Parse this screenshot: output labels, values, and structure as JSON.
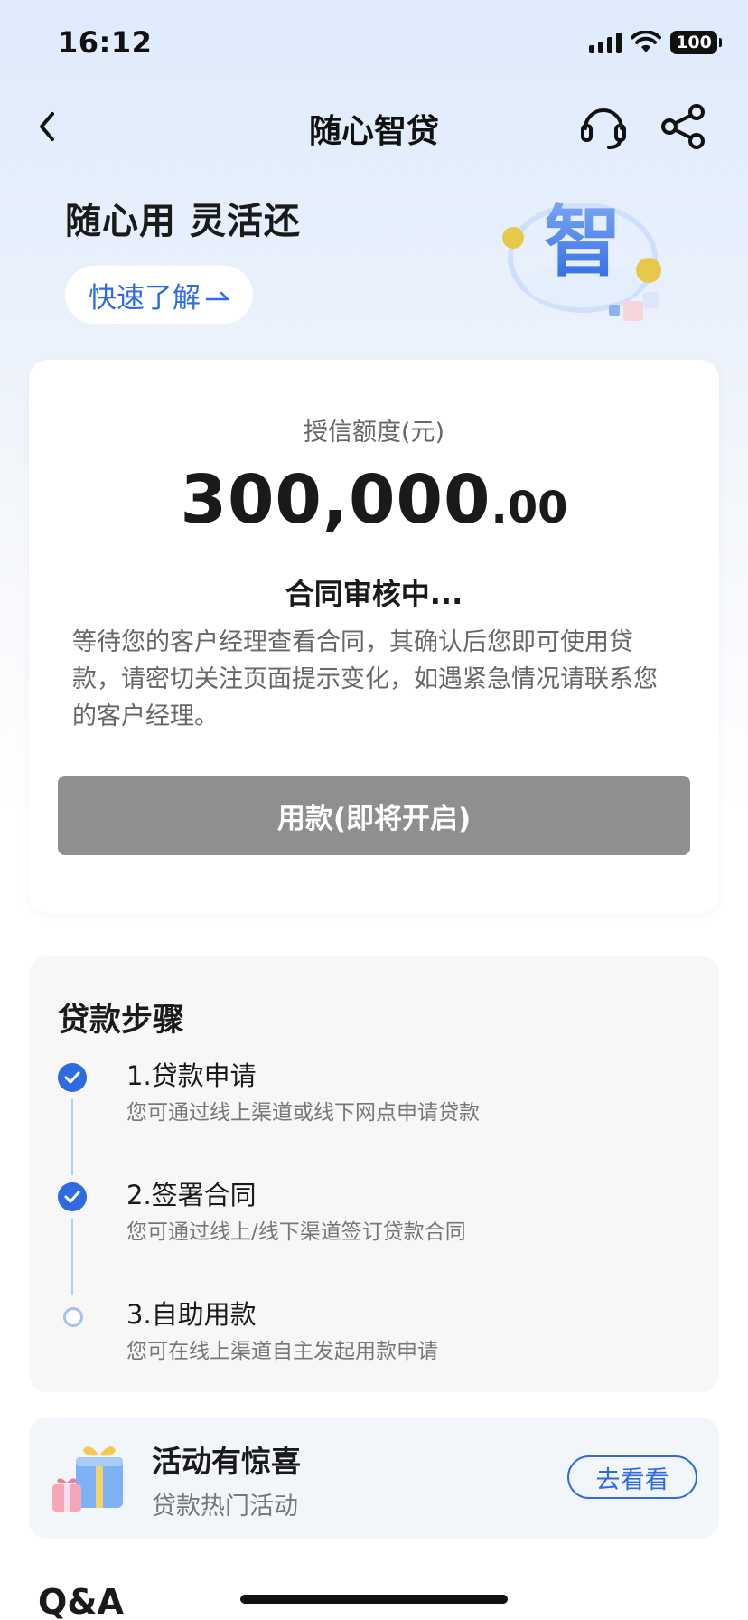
{
  "status_bar": {
    "time": "16:12",
    "battery": "100"
  },
  "nav": {
    "title": "随心智贷"
  },
  "hero": {
    "slogan": "随心用 灵活还",
    "learn_more": "快速了解",
    "graphic_char": "智"
  },
  "credit": {
    "label": "授信额度(元)",
    "amount_int": "300,000",
    "amount_dec": ".00",
    "status_title": "合同审核中...",
    "status_desc": "等待您的客户经理查看合同，其确认后您即可使用贷款，请密切关注页面提示变化，如遇紧急情况请联系您的客户经理。",
    "use_button": "用款(即将开启)"
  },
  "steps": {
    "title": "贷款步骤",
    "items": [
      {
        "name": "1.贷款申请",
        "desc": "您可通过线上渠道或线下网点申请贷款",
        "done": true
      },
      {
        "name": "2.签署合同",
        "desc": "您可通过线上/线下渠道签订贷款合同",
        "done": true
      },
      {
        "name": "3.自助用款",
        "desc": "您可在线上渠道自主发起用款申请",
        "done": false
      }
    ]
  },
  "promo": {
    "title": "活动有惊喜",
    "subtitle": "贷款热门活动",
    "button": "去看看"
  },
  "qa": {
    "title": "Q&A"
  },
  "colors": {
    "accent": "#2f6ae0",
    "disabled_button": "#8f8f8f",
    "page_bg": "#e8f0fc"
  }
}
